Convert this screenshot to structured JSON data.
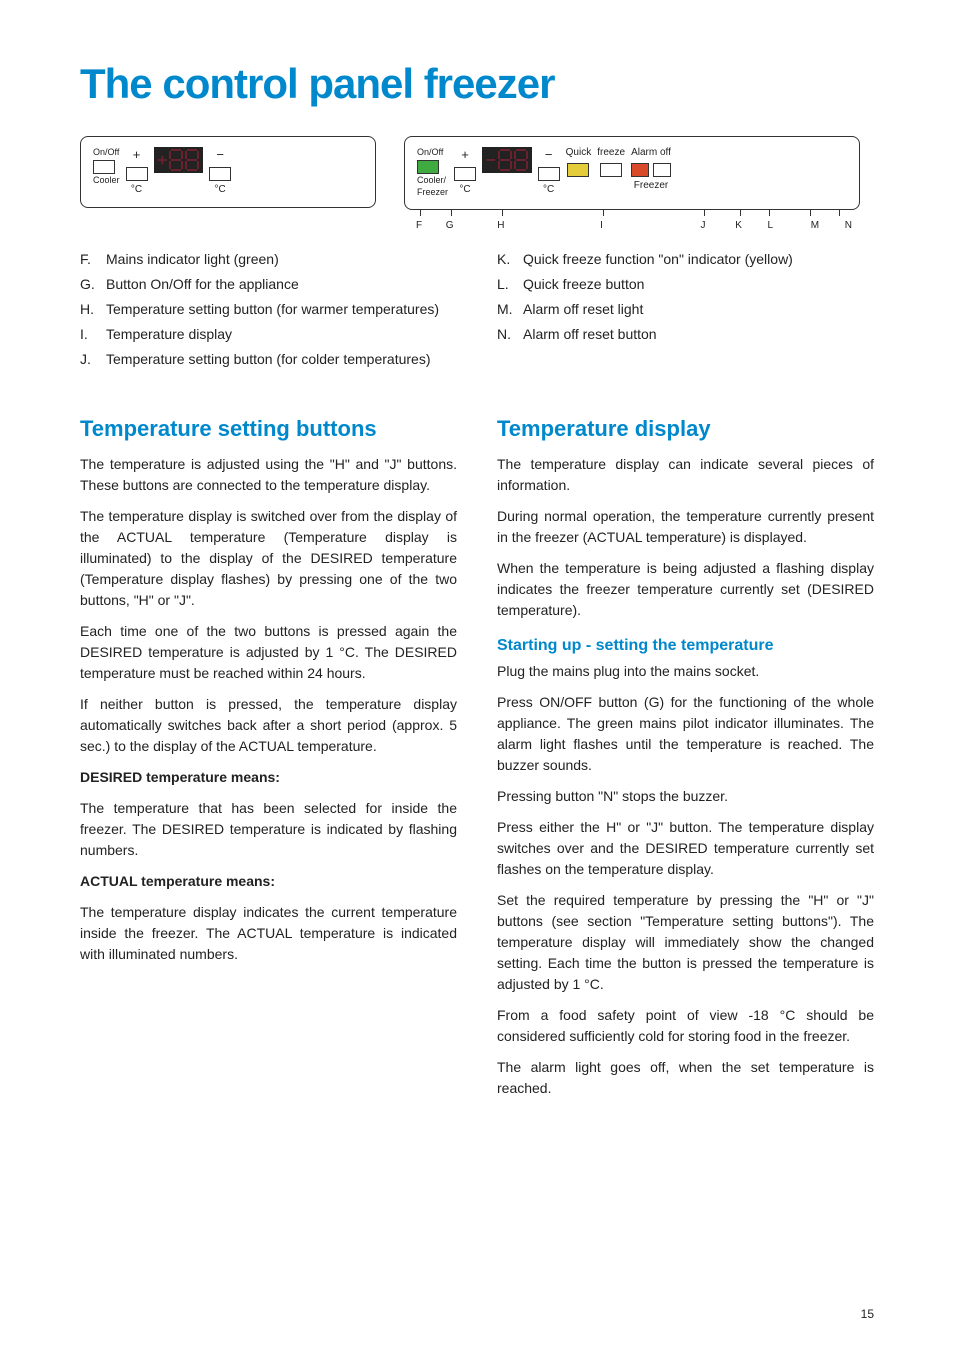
{
  "title": "The control panel freezer",
  "diagram": {
    "left": {
      "onoff": "On/Off",
      "cooler": "Cooler",
      "degC1": "°C",
      "degC2": "°C",
      "plus": "+",
      "minus": "−"
    },
    "right": {
      "onoff": "On/Off",
      "cooler_freezer1": "Cooler/",
      "cooler_freezer2": "Freezer",
      "degC1": "°C",
      "degC2": "°C",
      "plus": "+",
      "minus": "−",
      "quick": "Quick",
      "quick_freeze": "freeze",
      "alarm_off": "Alarm off",
      "freezer": "Freezer",
      "letters": {
        "F": "F",
        "G": "G",
        "H": "H",
        "I": "I",
        "J": "J",
        "K": "K",
        "L": "L",
        "M": "M",
        "N": "N"
      }
    }
  },
  "list_left": [
    {
      "letter": "F.",
      "text": "Mains indicator light (green)"
    },
    {
      "letter": "G.",
      "text": "Button On/Off for the appliance"
    },
    {
      "letter": "H.",
      "text": "Temperature setting button (for warmer temperatures)"
    },
    {
      "letter": "I.",
      "text": "Temperature display"
    },
    {
      "letter": "J.",
      "text": "Temperature setting button (for colder temperatures)"
    }
  ],
  "list_right": [
    {
      "letter": "K.",
      "text": "Quick freeze function \"on\" indicator (yellow)"
    },
    {
      "letter": "L.",
      "text": "Quick freeze button"
    },
    {
      "letter": "M.",
      "text": " Alarm off reset light"
    },
    {
      "letter": "N.",
      "text": "Alarm off reset button"
    }
  ],
  "sections": {
    "temp_setting": {
      "heading": "Temperature setting buttons",
      "p1": "The temperature is adjusted using the \"H\" and \"J\" buttons. These buttons are connected to the temperature display.",
      "p2": "The temperature display is switched over from the display of the ACTUAL temperature (Temperature display is illuminated) to the display of the DESIRED temperature (Temperature display flashes) by pressing one of the two buttons, \"H\" or \"J\".",
      "p3": "Each time one of the two buttons is pressed again the DESIRED temperature is adjusted by 1 °C. The DESIRED temperature must be reached within 24 hours.",
      "p4": "If neither button is pressed, the temperature display automatically switches back after a short period (approx. 5 sec.) to the display of the ACTUAL temperature.",
      "desired_h": "DESIRED temperature means:",
      "desired_p": "The temperature that has been selected for inside the freezer. The DESIRED temperature is indicated by flashing numbers.",
      "actual_h": "ACTUAL temperature means:",
      "actual_p": "The temperature display indicates the current temperature inside the freezer. The ACTUAL temperature is indicated with illuminated numbers."
    },
    "temp_display": {
      "heading": "Temperature display",
      "p1": "The temperature display can indicate several pieces of information.",
      "p2": "During normal operation, the temperature currently present in the freezer (ACTUAL temperature) is displayed.",
      "p3": "When the temperature is being adjusted a flashing display indicates the freezer temperature currently set (DESIRED temperature).",
      "sub_h": "Starting up - setting the temperature",
      "s1": "Plug the mains plug into the mains socket.",
      "s2": "Press ON/OFF button (G) for the functioning of the whole appliance. The green mains pilot indicator illuminates. The alarm light flashes until the temperature is reached. The buzzer sounds.",
      "s3": "Pressing button \"N\" stops the buzzer.",
      "s4": "Press either the H\" or \"J\" button. The temperature display switches over and the DESIRED temperature currently set flashes on the temperature display.",
      "s5": "Set the required temperature by pressing the \"H\" or \"J\" buttons (see section \"Temperature setting buttons\"). The temperature display will immediately show the changed setting. Each time the button is pressed the temperature is adjusted by 1 °C.",
      "s6": "From a food safety point of view -18 °C should be considered sufficiently cold for storing food in the freezer.",
      "s7": "The alarm light goes off, when the set temperature is reached."
    }
  },
  "page_number": "15"
}
